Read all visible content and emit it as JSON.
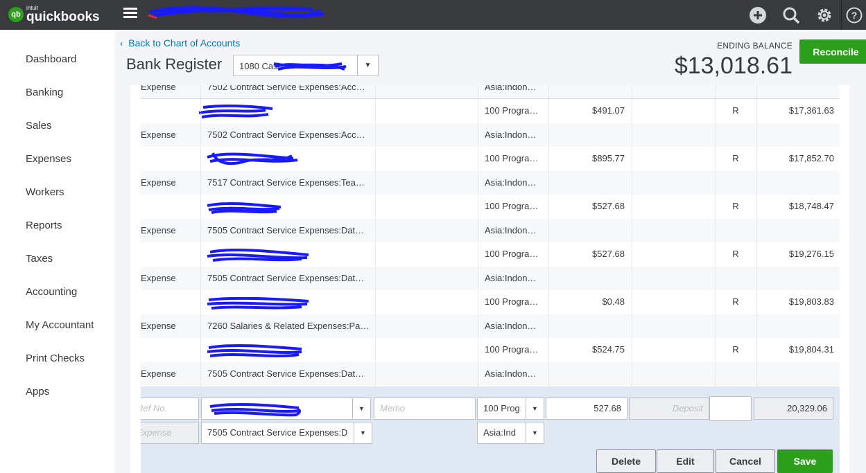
{
  "app": {
    "logo_small": "intuit",
    "logo_name": "quickbooks",
    "logo_mark": "qb"
  },
  "topbar": {
    "icons": [
      "plus-icon",
      "search-icon",
      "gear-icon",
      "help-icon"
    ]
  },
  "sidebar": {
    "items": [
      {
        "label": "Dashboard"
      },
      {
        "label": "Banking"
      },
      {
        "label": "Sales"
      },
      {
        "label": "Expenses"
      },
      {
        "label": "Workers"
      },
      {
        "label": "Reports"
      },
      {
        "label": "Taxes"
      },
      {
        "label": "Accounting"
      },
      {
        "label": "My Accountant"
      },
      {
        "label": "Print Checks"
      },
      {
        "label": "Apps"
      }
    ]
  },
  "header": {
    "back_link": "Back to Chart of Accounts",
    "title": "Bank Register",
    "account_value": "1080 Cash",
    "ending_balance_label": "ENDING BALANCE",
    "ending_balance": "$13,018.61",
    "reconcile_label": "Reconcile"
  },
  "register": {
    "top_partial": {
      "type": "Expense",
      "account": "7502 Contract Service Expenses:Acc…",
      "class": "Asia:Indon…"
    },
    "rows": [
      {
        "class": "100 Progra…",
        "payment": "$491.07",
        "status": "R",
        "balance": "$17,361.63",
        "type": "Expense",
        "account": "7502 Contract Service Expenses:Acc…",
        "location": "Asia:Indon…"
      },
      {
        "class": "100 Progra…",
        "payment": "$895.77",
        "status": "R",
        "balance": "$17,852.70",
        "type": "Expense",
        "account": "7517 Contract Service Expenses:Tea…",
        "location": "Asia:Indon…"
      },
      {
        "class": "100 Progra…",
        "payment": "$527.68",
        "status": "R",
        "balance": "$18,748.47",
        "type": "Expense",
        "account": "7505 Contract Service Expenses:Dat…",
        "location": "Asia:Indon…"
      },
      {
        "class": "100 Progra…",
        "payment": "$527.68",
        "status": "R",
        "balance": "$19,276.15",
        "type": "Expense",
        "account": "7505 Contract Service Expenses:Dat…",
        "location": "Asia:Indon…"
      },
      {
        "class": "100 Progra…",
        "payment": "$0.48",
        "status": "R",
        "balance": "$19,803.83",
        "type": "Expense",
        "account": "7260 Salaries & Related Expenses:Pa…",
        "location": "Asia:Indon…"
      },
      {
        "class": "100 Progra…",
        "payment": "$524.75",
        "status": "R",
        "balance": "$19,804.31",
        "type": "Expense",
        "account": "7505 Contract Service Expenses:Dat…",
        "location": "Asia:Indon…"
      }
    ]
  },
  "edit_row": {
    "ref_placeholder": "Ref No.",
    "memo_placeholder": "Memo",
    "class_value": "100 Prog",
    "payment_value": "527.68",
    "deposit_placeholder": "Deposit",
    "balance_value": "20,329.06",
    "type_value": "Expense",
    "account_value": "7505 Contract Service Expenses:D",
    "location_value": "Asia:Ind",
    "buttons": {
      "delete": "Delete",
      "edit": "Edit",
      "cancel": "Cancel",
      "save": "Save"
    }
  },
  "colors": {
    "topbar": "#393a3d",
    "brand_green": "#2ca01c",
    "link_blue": "#0077c5",
    "redaction_blue": "#1a1aff"
  }
}
